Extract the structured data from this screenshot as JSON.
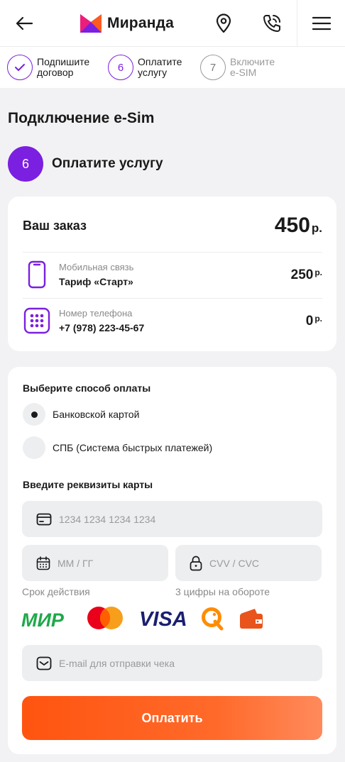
{
  "header": {
    "logo_text": "Миранда",
    "colors": {
      "brand_purple": "#7b1fe0",
      "logo_pink": "#ec1e7a",
      "accent_orange": "#ff5a1f"
    }
  },
  "steps": [
    {
      "number": "✓",
      "label_line1": "Подпишите",
      "label_line2": "договор",
      "state": "done"
    },
    {
      "number": "6",
      "label_line1": "Оплатите",
      "label_line2": "услугу",
      "state": "current"
    },
    {
      "number": "7",
      "label_line1": "Включите",
      "label_line2": "e-SIM",
      "state": "upcoming"
    }
  ],
  "page_title": "Подключение e-Sim",
  "current_step": {
    "number": "6",
    "label": "Оплатите услугу"
  },
  "order": {
    "title": "Ваш заказ",
    "total": "450",
    "currency": "р.",
    "items": [
      {
        "icon": "smartphone-icon",
        "label": "Мобильная связь",
        "value": "Тариф «Старт»",
        "price": "250",
        "currency": "р."
      },
      {
        "icon": "keypad-icon",
        "label": "Номер телефона",
        "value": "+7 (978) 223-45-67",
        "price": "0",
        "currency": "р."
      }
    ]
  },
  "payment": {
    "method_title": "Выберите способ оплаты",
    "methods": [
      {
        "label": "Банковской картой",
        "selected": true
      },
      {
        "label": "СПБ (Система быстрых платежей)",
        "selected": false
      }
    ],
    "card_title": "Введите реквизиты карты",
    "card_number_placeholder": "1234 1234 1234 1234",
    "expiry_placeholder": "ММ / ГГ",
    "cvv_placeholder": "CVV / CVC",
    "expiry_hint": "Срок действия",
    "cvv_hint": "3 цифры на обороте",
    "logos": [
      "mir-logo",
      "mastercard-logo",
      "visa-logo",
      "qiwi-logo",
      "wallet-logo"
    ],
    "mir_text": "МИР",
    "visa_text": "VISA",
    "email_placeholder": "E-mail для отправки чека",
    "pay_button": "Оплатить"
  }
}
